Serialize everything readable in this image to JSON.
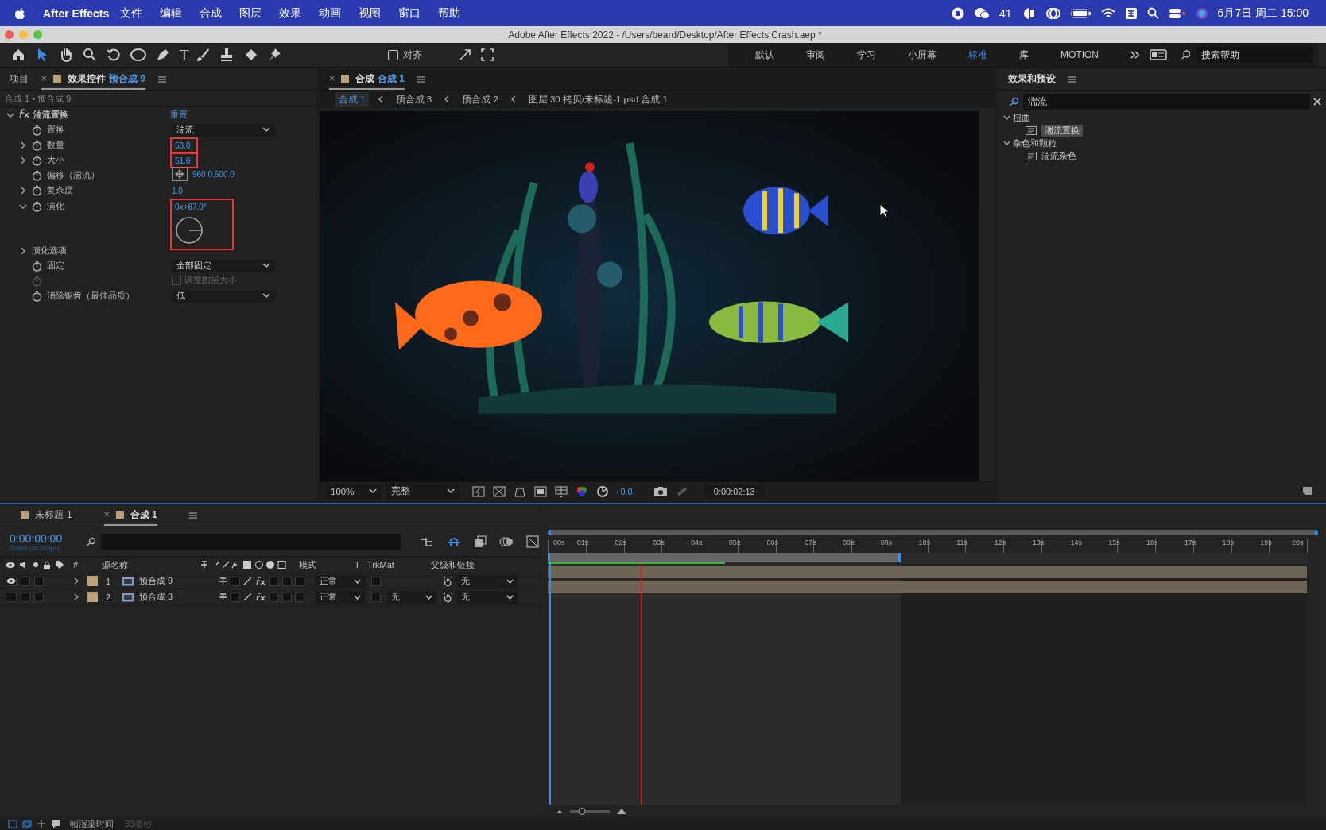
{
  "menubar": {
    "app_name": "After Effects",
    "menus": [
      "文件",
      "编辑",
      "合成",
      "图层",
      "效果",
      "动画",
      "视图",
      "窗口",
      "帮助"
    ],
    "chat_count": "41",
    "datetime": "6月7日 周二 15:00"
  },
  "window": {
    "title": "Adobe After Effects 2022 - /Users/beard/Desktop/After Effects Crash.aep *"
  },
  "toolbar": {
    "tools": [
      {
        "kind": "home",
        "selected": false
      },
      {
        "kind": "select",
        "selected": true
      },
      {
        "kind": "hand",
        "selected": false
      },
      {
        "kind": "zoom",
        "selected": false
      },
      {
        "kind": "rotate",
        "selected": false
      },
      {
        "kind": "ellipse",
        "selected": false
      },
      {
        "kind": "pen",
        "selected": false
      },
      {
        "kind": "text",
        "label": "T",
        "selected": false
      },
      {
        "kind": "brush",
        "selected": false
      },
      {
        "kind": "stamp",
        "selected": false
      },
      {
        "kind": "eraser",
        "selected": false
      },
      {
        "kind": "pin",
        "selected": false
      }
    ],
    "align_label": "对齐",
    "align_checked": false,
    "workspaces": [
      {
        "label": "默认",
        "selected": false
      },
      {
        "label": "审阅",
        "selected": false
      },
      {
        "label": "学习",
        "selected": false
      },
      {
        "label": "小屏幕",
        "selected": false
      },
      {
        "label": "标准",
        "selected": true
      },
      {
        "label": "库",
        "selected": false
      },
      {
        "label": "MOTION",
        "selected": false
      }
    ],
    "search_placeholder": "搜索帮助"
  },
  "effect_panel": {
    "tabs": [
      {
        "label": "项目",
        "selected": false
      },
      {
        "label": "效果控件",
        "suffix": "预合成 9",
        "close": "×",
        "selected": true
      }
    ],
    "breadcrumb": "合成 1 • 预合成 9",
    "effect": {
      "name": "湍流置换",
      "reset": "重置"
    },
    "params": [
      {
        "kind": "dropdown",
        "name": "置换",
        "value": "湍流",
        "highlighted": false
      },
      {
        "kind": "number",
        "name": "数量",
        "value": "58.0",
        "expanded": false,
        "highlighted": true
      },
      {
        "kind": "number",
        "name": "大小",
        "value": "51.0",
        "expanded": false,
        "highlighted": true
      },
      {
        "kind": "point",
        "name": "偏移（湍流）",
        "value": "960.0,600.0",
        "highlighted": false
      },
      {
        "kind": "number",
        "name": "复杂度",
        "value": "1.0",
        "expanded": false,
        "highlighted": false
      },
      {
        "kind": "angle",
        "name": "演化",
        "value": "0x+87.0°",
        "expanded": true,
        "highlighted": true
      },
      {
        "kind": "group",
        "name": "演化选项",
        "expanded": false,
        "highlighted": false
      },
      {
        "kind": "dropdown",
        "name": "固定",
        "value": "全部固定",
        "highlighted": false
      },
      {
        "kind": "checkbox",
        "value": "调整图层大小",
        "checked": false,
        "disabled": true,
        "highlighted": false
      },
      {
        "kind": "dropdown",
        "name": "消除锯齿（最佳品质）",
        "value": "低",
        "highlighted": false
      }
    ]
  },
  "viewer": {
    "close": "×",
    "tab_label": "合成",
    "tab_name": "合成 1",
    "breadcrumbs": [
      {
        "label": "合成 1",
        "selected": true
      },
      {
        "label": "预合成 3",
        "selected": false
      },
      {
        "label": "预合成 2",
        "selected": false
      },
      {
        "label": "图层 30 拷贝/未标题-1.psd 合成 1",
        "selected": false
      }
    ],
    "zoom": "100%",
    "resolution": "完整",
    "exposure": "+0.0",
    "timecode": "0:00:02:13"
  },
  "effects_presets": {
    "title": "效果和预设",
    "search_value": "湍流",
    "tree": [
      {
        "label": "扭曲",
        "expanded": true,
        "children": [
          {
            "label": "湍流置换",
            "selected": true
          }
        ]
      },
      {
        "label": "杂色和颗粒",
        "expanded": true,
        "children": [
          {
            "label": "湍流杂色",
            "selected": false
          }
        ]
      }
    ]
  },
  "timeline": {
    "tabs": [
      {
        "label": "未标题-1",
        "selected": false
      },
      {
        "label": "合成 1",
        "close": "×",
        "selected": true
      }
    ],
    "timecode": "0:00:00:00",
    "fps": "00000 (30.00 fps)",
    "columns": {
      "number": "#",
      "source": "源名称",
      "mode": "模式",
      "t": "T",
      "trkmat": "TrkMat",
      "parent": "父级和链接"
    },
    "layers": [
      {
        "index": "1",
        "name": "预合成 9",
        "visible": true,
        "mode": "正常",
        "parent": "无"
      },
      {
        "index": "2",
        "name": "预合成 3",
        "visible": false,
        "mode": "正常",
        "trkmat": "无",
        "parent": "无"
      }
    ],
    "ticks": [
      "00s",
      "01s",
      "02s",
      "03s",
      "04s",
      "05s",
      "06s",
      "07s",
      "08s",
      "09s",
      "10s",
      "11s",
      "12s",
      "13s",
      "14s",
      "15s",
      "16s",
      "17s",
      "18s",
      "19s",
      "20s"
    ],
    "work_area": {
      "level": 0.465
    },
    "render": {
      "level": 0.233
    },
    "playhead": {
      "level": 0
    },
    "marker": {
      "level": 0.122
    },
    "zoom": {
      "level": 0.3
    }
  },
  "status_bar": {
    "label": "帧渲染时间",
    "value": "33毫秒"
  }
}
